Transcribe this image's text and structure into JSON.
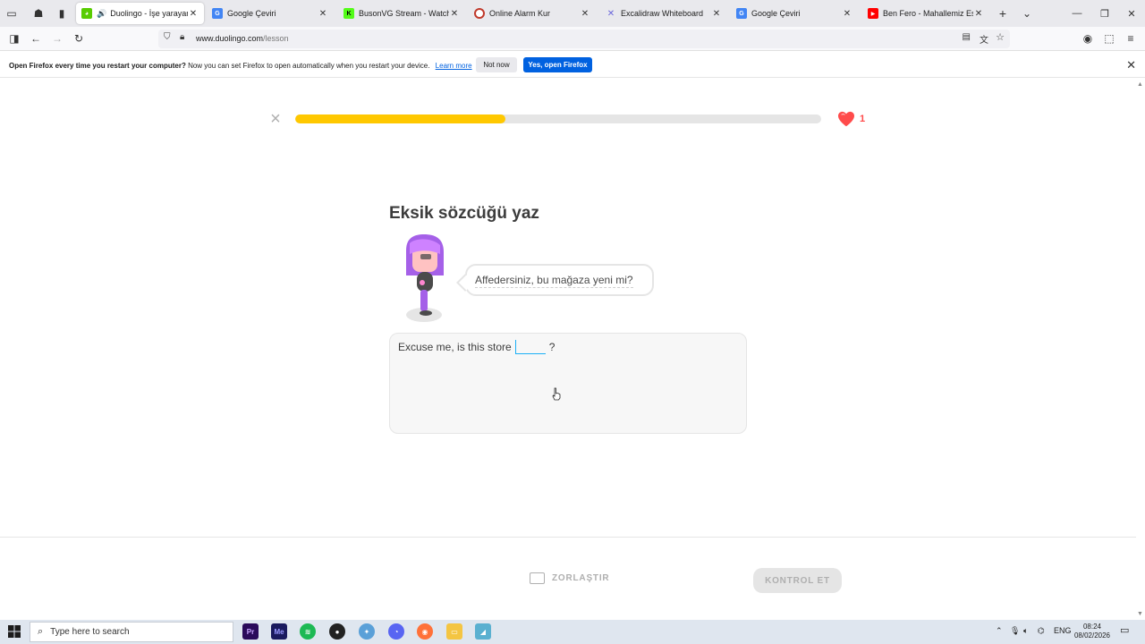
{
  "browser": {
    "tabs": [
      {
        "title": "Duolingo - İşe yarayan de",
        "favicon": "duolingo-icon",
        "active": true
      },
      {
        "title": "Google Çeviri",
        "favicon": "translate-icon",
        "active": false
      },
      {
        "title": "BusonVG Stream - Watch Live",
        "favicon": "kick-icon",
        "active": false
      },
      {
        "title": "Online Alarm Kur",
        "favicon": "alarm-icon",
        "active": false
      },
      {
        "title": "Excalidraw Whiteboard",
        "favicon": "excalidraw-icon",
        "active": false
      },
      {
        "title": "Google Çeviri",
        "favicon": "translate-icon",
        "active": false
      },
      {
        "title": "Ben Fero - Mahallemiz Esmer",
        "favicon": "youtube-icon",
        "active": false
      }
    ],
    "url": {
      "domain": "www.duolingo.com",
      "path": "/lesson"
    }
  },
  "notification": {
    "bold_text": "Open Firefox every time you restart your computer?",
    "text": "Now you can set Firefox to open automatically when you restart your device.",
    "link": "Learn more",
    "not_now": "Not now",
    "yes": "Yes, open Firefox"
  },
  "lesson": {
    "progress_percent": 40,
    "hearts": "1",
    "instruction": "Eksik sözcüğü yaz",
    "prompt": "Affedersiniz, bu mağaza yeni mi?",
    "sentence_before": "Excuse me, is this store",
    "sentence_after": "?",
    "blank_value": "",
    "harder_label": "ZORLAŞTIR",
    "check_label": "KONTROL ET"
  },
  "colors": {
    "progress": "#ffc800",
    "heart": "#ff4b4b",
    "blank_underline": "#1cb0f6",
    "firefox_blue": "#0061e0"
  },
  "taskbar": {
    "search_placeholder": "Type here to search",
    "apps": [
      "premiere-pro-icon",
      "media-encoder-icon",
      "spotify-icon",
      "obs-icon",
      "app-icon",
      "discord-icon",
      "firefox-icon",
      "file-explorer-icon",
      "app-icon"
    ],
    "language": "ENG",
    "time": "08:24",
    "date": "08/02/2026"
  }
}
